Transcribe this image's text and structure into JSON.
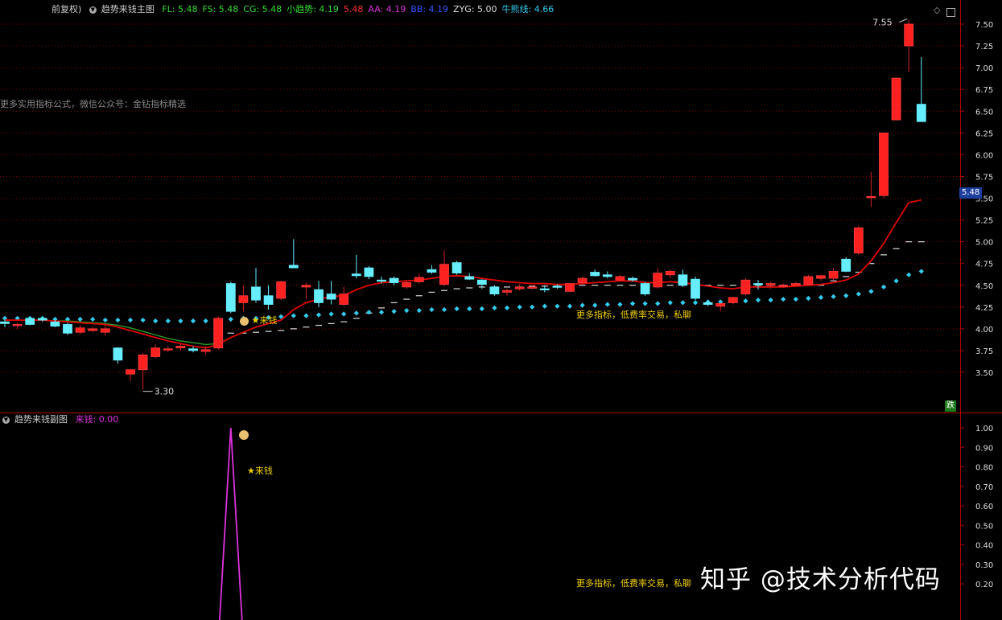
{
  "colors": {
    "background": "#000000",
    "grid": "#b00000",
    "up": "#ff2020",
    "down": "#66eeff",
    "ma_red": "#e00000",
    "ma_green": "#2a9a2a",
    "dots": "#33ccee",
    "steps": "#cccccc",
    "pink": "#dd33dd",
    "yellow": "#f0d000"
  },
  "main_header": {
    "prefix": "前复权)",
    "indicator_name": "趋势来钱主图",
    "items": [
      {
        "label": "FL: 5.48",
        "color": "#33dd33"
      },
      {
        "label": "FS: 5.48",
        "color": "#33dd33"
      },
      {
        "label": "CG: 5.48",
        "color": "#33dd33"
      },
      {
        "label": "小趋势: 4.19",
        "color": "#33dd33"
      },
      {
        "label": "5.48",
        "color": "#ff3030"
      },
      {
        "label": "AA: 4.19",
        "color": "#dd33dd"
      },
      {
        "label": "BB: 4.19",
        "color": "#3355ff"
      },
      {
        "label": "ZYG: 5.00",
        "color": "#dddddd"
      },
      {
        "label": "牛熊线: 4.66",
        "color": "#33ccee"
      }
    ]
  },
  "main_notes": {
    "formula_note": "更多实用指标公式，微信公众号：金钻指标精选",
    "ad_note": "更多指标，低费率交易，私聊",
    "signal_label": "来钱",
    "current_price": "5.48",
    "die_label": "跌"
  },
  "sub_header": {
    "indicator_name": "趋势来钱副图",
    "value_label": "来钱: 0.00"
  },
  "sub_notes": {
    "signal_label": "来钱",
    "ad_note": "更多指标，低费率交易，私聊"
  },
  "watermark": "知乎 @技术分析代码",
  "chart_data": [
    {
      "type": "candlestick",
      "title": "趋势来钱主图",
      "ylim": [
        3.2,
        7.65
      ],
      "y_ticks": [
        "3.50",
        "3.75",
        "4.00",
        "4.25",
        "4.50",
        "4.75",
        "5.00",
        "5.25",
        "5.50",
        "5.75",
        "6.00",
        "6.25",
        "6.50",
        "6.75",
        "7.00",
        "7.25",
        "7.50"
      ],
      "annotations": {
        "high_label": "7.55",
        "low_label": "3.30"
      },
      "candles": [
        [
          4.08,
          4.1,
          4.02,
          4.06
        ],
        [
          4.05,
          4.07,
          4.0,
          4.05
        ],
        [
          4.12,
          4.14,
          4.04,
          4.05
        ],
        [
          4.12,
          4.14,
          4.08,
          4.1
        ],
        [
          4.08,
          4.1,
          4.02,
          4.03
        ],
        [
          4.05,
          4.07,
          3.93,
          3.95
        ],
        [
          3.96,
          4.04,
          3.94,
          4.01
        ],
        [
          3.98,
          4.02,
          3.96,
          4.0
        ],
        [
          3.96,
          4.04,
          3.92,
          4.0
        ],
        [
          3.78,
          3.79,
          3.6,
          3.64
        ],
        [
          3.48,
          3.53,
          3.4,
          3.53
        ],
        [
          3.53,
          3.72,
          3.3,
          3.7
        ],
        [
          3.68,
          3.82,
          3.66,
          3.78
        ],
        [
          3.76,
          3.8,
          3.73,
          3.77
        ],
        [
          3.78,
          3.83,
          3.75,
          3.8
        ],
        [
          3.77,
          3.8,
          3.73,
          3.75
        ],
        [
          3.74,
          3.8,
          3.7,
          3.76
        ],
        [
          3.78,
          4.14,
          3.76,
          4.12
        ],
        [
          4.52,
          4.54,
          4.18,
          4.2
        ],
        [
          4.3,
          4.5,
          4.2,
          4.38
        ],
        [
          4.48,
          4.7,
          4.3,
          4.33
        ],
        [
          4.38,
          4.5,
          4.22,
          4.28
        ],
        [
          4.35,
          4.55,
          4.33,
          4.54
        ],
        [
          4.73,
          5.03,
          4.7,
          4.7
        ],
        [
          4.48,
          4.53,
          4.34,
          4.5
        ],
        [
          4.45,
          4.55,
          4.25,
          4.3
        ],
        [
          4.4,
          4.55,
          4.28,
          4.34
        ],
        [
          4.28,
          4.48,
          4.26,
          4.4
        ],
        [
          4.63,
          4.85,
          4.58,
          4.61
        ],
        [
          4.7,
          4.72,
          4.57,
          4.6
        ],
        [
          4.56,
          4.6,
          4.52,
          4.55
        ],
        [
          4.58,
          4.6,
          4.5,
          4.53
        ],
        [
          4.48,
          4.56,
          4.46,
          4.53
        ],
        [
          4.54,
          4.64,
          4.52,
          4.59
        ],
        [
          4.68,
          4.73,
          4.63,
          4.65
        ],
        [
          4.51,
          4.9,
          4.49,
          4.74
        ],
        [
          4.76,
          4.78,
          4.62,
          4.64
        ],
        [
          4.6,
          4.64,
          4.56,
          4.57
        ],
        [
          4.56,
          4.57,
          4.46,
          4.51
        ],
        [
          4.48,
          4.5,
          4.38,
          4.4
        ],
        [
          4.42,
          4.46,
          4.38,
          4.44
        ],
        [
          4.46,
          4.51,
          4.44,
          4.48
        ],
        [
          4.48,
          4.5,
          4.45,
          4.48
        ],
        [
          4.46,
          4.5,
          4.42,
          4.45
        ],
        [
          4.49,
          4.51,
          4.46,
          4.48
        ],
        [
          4.43,
          4.52,
          4.42,
          4.52
        ],
        [
          4.53,
          4.6,
          4.51,
          4.58
        ],
        [
          4.65,
          4.68,
          4.6,
          4.61
        ],
        [
          4.62,
          4.66,
          4.58,
          4.6
        ],
        [
          4.56,
          4.62,
          4.55,
          4.6
        ],
        [
          4.58,
          4.6,
          4.54,
          4.56
        ],
        [
          4.52,
          4.54,
          4.38,
          4.4
        ],
        [
          4.48,
          4.7,
          4.46,
          4.64
        ],
        [
          4.62,
          4.68,
          4.58,
          4.66
        ],
        [
          4.62,
          4.68,
          4.48,
          4.5
        ],
        [
          4.57,
          4.6,
          4.33,
          4.35
        ],
        [
          4.3,
          4.32,
          4.26,
          4.28
        ],
        [
          4.26,
          4.3,
          4.2,
          4.29
        ],
        [
          4.3,
          4.36,
          4.28,
          4.36
        ],
        [
          4.4,
          4.58,
          4.38,
          4.56
        ],
        [
          4.52,
          4.56,
          4.45,
          4.51
        ],
        [
          4.5,
          4.54,
          4.46,
          4.52
        ],
        [
          4.5,
          4.52,
          4.47,
          4.5
        ],
        [
          4.5,
          4.54,
          4.48,
          4.52
        ],
        [
          4.51,
          4.62,
          4.5,
          4.6
        ],
        [
          4.58,
          4.62,
          4.55,
          4.61
        ],
        [
          4.58,
          4.7,
          4.56,
          4.66
        ],
        [
          4.8,
          4.82,
          4.65,
          4.66
        ],
        [
          4.87,
          5.18,
          4.85,
          5.16
        ],
        [
          5.52,
          5.8,
          5.4,
          5.52
        ],
        [
          5.53,
          6.25,
          5.5,
          6.25
        ],
        [
          6.4,
          6.88,
          6.4,
          6.88
        ],
        [
          7.25,
          7.55,
          6.95,
          7.5
        ],
        [
          6.58,
          7.12,
          6.4,
          6.38
        ]
      ],
      "ma_red": [
        4.1,
        4.1,
        4.1,
        4.1,
        4.09,
        4.08,
        4.07,
        4.06,
        4.05,
        4.02,
        3.98,
        3.94,
        3.9,
        3.86,
        3.83,
        3.8,
        3.78,
        3.82,
        3.9,
        3.96,
        4.02,
        4.06,
        4.1,
        4.22,
        4.3,
        4.34,
        4.37,
        4.38,
        4.45,
        4.5,
        4.53,
        4.54,
        4.55,
        4.56,
        4.58,
        4.6,
        4.61,
        4.6,
        4.58,
        4.56,
        4.54,
        4.53,
        4.52,
        4.52,
        4.51,
        4.51,
        4.52,
        4.53,
        4.54,
        4.55,
        4.55,
        4.53,
        4.53,
        4.54,
        4.53,
        4.51,
        4.49,
        4.47,
        4.46,
        4.48,
        4.48,
        4.48,
        4.48,
        4.49,
        4.5,
        4.51,
        4.53,
        4.56,
        4.63,
        4.78,
        4.98,
        5.22,
        5.45,
        5.48
      ],
      "ma_green": [
        4.1,
        4.1,
        4.1,
        4.1,
        4.09,
        4.09,
        4.08,
        4.07,
        4.06,
        4.04,
        4.01,
        3.97,
        3.93,
        3.89,
        3.86,
        3.84,
        3.82,
        3.83,
        3.9,
        3.96,
        4.02,
        4.06,
        4.1,
        4.22,
        4.3,
        4.34,
        4.37,
        4.38,
        4.45,
        4.5,
        4.53,
        4.54,
        4.55,
        4.56,
        4.58,
        4.6,
        4.61,
        4.6,
        4.58,
        4.56,
        4.54,
        4.53,
        4.52,
        4.52,
        4.51,
        4.51,
        4.52,
        4.53,
        4.54,
        4.55,
        4.55,
        4.53,
        4.53,
        4.54,
        4.53,
        4.51,
        4.49,
        4.47,
        4.46,
        4.48,
        4.48,
        4.48,
        4.48,
        4.49,
        4.5,
        4.51,
        4.53,
        4.56,
        4.63,
        4.78,
        4.98,
        5.22,
        5.45,
        5.48
      ],
      "dots": [
        4.12,
        4.12,
        4.12,
        4.12,
        4.11,
        4.11,
        4.11,
        4.11,
        4.1,
        4.1,
        4.1,
        4.1,
        4.09,
        4.09,
        4.09,
        4.09,
        4.09,
        4.1,
        4.11,
        4.12,
        4.12,
        4.13,
        4.14,
        4.15,
        4.15,
        4.16,
        4.17,
        4.17,
        4.18,
        4.19,
        4.19,
        4.2,
        4.21,
        4.21,
        4.22,
        4.22,
        4.23,
        4.23,
        4.23,
        4.24,
        4.24,
        4.25,
        4.25,
        4.26,
        4.26,
        4.26,
        4.27,
        4.27,
        4.28,
        4.28,
        4.29,
        4.29,
        4.29,
        4.3,
        4.3,
        4.3,
        4.31,
        4.31,
        4.32,
        4.32,
        4.33,
        4.33,
        4.34,
        4.34,
        4.35,
        4.36,
        4.37,
        4.38,
        4.4,
        4.43,
        4.48,
        4.55,
        4.62,
        4.66
      ],
      "steps": [
        null,
        null,
        null,
        null,
        null,
        null,
        null,
        null,
        null,
        null,
        null,
        null,
        null,
        null,
        null,
        null,
        null,
        null,
        3.95,
        3.95,
        3.96,
        3.97,
        3.98,
        4.0,
        4.02,
        4.04,
        4.06,
        4.08,
        4.12,
        4.18,
        4.24,
        4.3,
        4.34,
        4.38,
        4.42,
        4.44,
        4.46,
        4.47,
        4.48,
        4.48,
        4.48,
        4.48,
        4.49,
        4.49,
        4.49,
        4.5,
        4.5,
        4.5,
        4.5,
        4.5,
        4.5,
        4.5,
        4.5,
        4.5,
        4.5,
        4.5,
        4.5,
        4.5,
        4.5,
        4.5,
        4.5,
        4.5,
        4.5,
        4.5,
        4.5,
        4.5,
        4.55,
        4.6,
        4.65,
        4.75,
        4.85,
        4.92,
        5.0,
        5.0
      ]
    },
    {
      "type": "line",
      "title": "趋势来钱副图",
      "ylim": [
        0,
        1.05
      ],
      "y_ticks": [
        "0.20",
        "0.30",
        "0.40",
        "0.50",
        "0.60",
        "0.70",
        "0.80",
        "0.90",
        "1.00"
      ],
      "series": [
        {
          "values": [
            0,
            0,
            0,
            0,
            0,
            0,
            0,
            0,
            0,
            0,
            0,
            0,
            0,
            0,
            0,
            0,
            0,
            0,
            1.0,
            0,
            0,
            0,
            0,
            0,
            0,
            0,
            0,
            0,
            0,
            0,
            0,
            0,
            0,
            0,
            0,
            0,
            0,
            0,
            0,
            0,
            0,
            0,
            0,
            0,
            0,
            0,
            0,
            0,
            0,
            0,
            0,
            0,
            0,
            0,
            0,
            0,
            0,
            0,
            0,
            0,
            0,
            0,
            0,
            0,
            0,
            0,
            0,
            0,
            0,
            0,
            0,
            0,
            0,
            0
          ]
        }
      ]
    }
  ]
}
